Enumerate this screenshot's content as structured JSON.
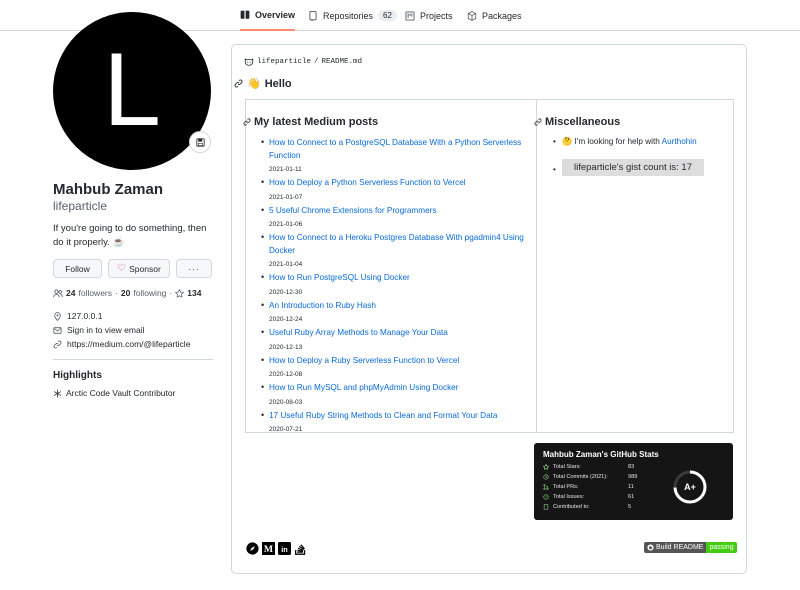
{
  "nav": {
    "tabs": [
      {
        "label": "Overview",
        "icon": "book-icon"
      },
      {
        "label": "Repositories",
        "icon": "repo-icon",
        "count": "62"
      },
      {
        "label": "Projects",
        "icon": "project-icon"
      },
      {
        "label": "Packages",
        "icon": "package-icon"
      }
    ]
  },
  "profile": {
    "avatar_letter": "L",
    "full_name": "Mahbub Zaman",
    "username": "lifeparticle",
    "bio": "If you're going to do something, then do it properly. ☕",
    "follow_label": "Follow",
    "sponsor_label": "Sponsor",
    "more_label": "···",
    "followers_count": "24",
    "followers_label": "followers",
    "following_count": "20",
    "following_label": "following",
    "stars_count": "134",
    "location": "127.0.0.1",
    "email": "Sign in to view email",
    "website": "https://medium.com/@lifeparticle",
    "highlights_heading": "Highlights",
    "highlight_item": "Arctic Code Vault Contributor"
  },
  "readme": {
    "owner": "lifeparticle",
    "separator": "/",
    "file": "README.md",
    "heading": "Hello",
    "heading_emoji": "👋",
    "left_heading": "My latest Medium posts",
    "right_heading": "Miscellaneous",
    "posts": [
      {
        "title": "How to Connect to a PostgreSQL Database With a Python Serverless Function",
        "date": "2021-01-11"
      },
      {
        "title": "How to Deploy a Python Serverless Function to Vercel",
        "date": "2021-01-07"
      },
      {
        "title": "5 Useful Chrome Extensions for Programmers",
        "date": "2021-01-06"
      },
      {
        "title": "How to Connect to a Heroku Postgres Database With pgadmin4 Using Docker",
        "date": "2021-01-04"
      },
      {
        "title": "How to Run PostgreSQL Using Docker",
        "date": "2020-12-30"
      },
      {
        "title": "An Introduction to Ruby Hash",
        "date": "2020-12-24"
      },
      {
        "title": "Useful Ruby Array Methods to Manage Your Data",
        "date": "2020-12-13"
      },
      {
        "title": "How to Deploy a Ruby Serverless Function to Vercel",
        "date": "2020-12-08"
      },
      {
        "title": "How to Run MySQL and phpMyAdmin Using Docker",
        "date": "2020-08-03"
      },
      {
        "title": "17 Useful Ruby String Methods to Clean and Format Your Data",
        "date": "2020-07-21"
      }
    ],
    "misc_text": "I'm looking for help with",
    "misc_emoji": "🤔",
    "misc_link": "Aurthohin",
    "gist_text": "lifeparticle's gist count is: 17"
  },
  "stats_card": {
    "title": "Mahbub Zaman's GitHub Stats",
    "rows": [
      {
        "label": "Total Stars:",
        "value": "83",
        "icon": "star-icon"
      },
      {
        "label": "Total Commits (2021):",
        "value": "989",
        "icon": "commit-icon"
      },
      {
        "label": "Total PRs:",
        "value": "11",
        "icon": "pr-icon"
      },
      {
        "label": "Total Issues:",
        "value": "61",
        "icon": "issue-icon"
      },
      {
        "label": "Contributed to:",
        "value": "5",
        "icon": "repo-icon"
      }
    ],
    "grade": "A+",
    "colors": {
      "background": "#151515",
      "ring": "#ffffff",
      "text": "#ffffff"
    }
  },
  "badge": {
    "left": "Build README",
    "right": "passing",
    "colors": {
      "left": "#555555",
      "right": "#44cc11"
    }
  },
  "colors": {
    "link": "#0969da",
    "tab_underline": "#fd8c73",
    "sponsor_heart": "#bf3989",
    "border": "#d0d7de"
  }
}
